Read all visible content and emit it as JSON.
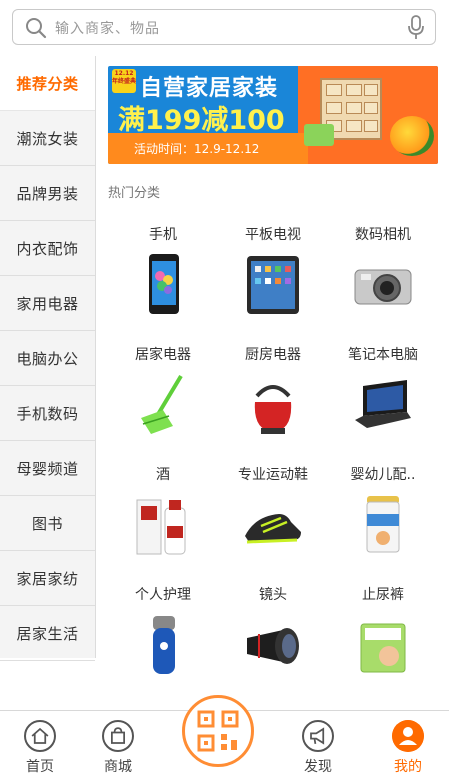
{
  "search": {
    "placeholder": "输入商家、物品"
  },
  "sidebar": {
    "items": [
      {
        "label": "推荐分类",
        "active": true
      },
      {
        "label": "潮流女装"
      },
      {
        "label": "品牌男装"
      },
      {
        "label": "内衣配饰"
      },
      {
        "label": "家用电器"
      },
      {
        "label": "电脑办公"
      },
      {
        "label": "手机数码"
      },
      {
        "label": "母婴频道"
      },
      {
        "label": "图书"
      },
      {
        "label": "家居家纺"
      },
      {
        "label": "居家生活"
      }
    ]
  },
  "banner": {
    "tag": "12.12 年终盛典",
    "title": "自营家居家装",
    "subtitle": "满199减100",
    "date": "活动时间：12.9-12.12"
  },
  "hot": {
    "title": "热门分类",
    "items": [
      {
        "label": "手机",
        "icon": "phone-icon"
      },
      {
        "label": "平板电视",
        "icon": "tablet-icon"
      },
      {
        "label": "数码相机",
        "icon": "camera-icon"
      },
      {
        "label": "居家电器",
        "icon": "broom-icon"
      },
      {
        "label": "厨房电器",
        "icon": "kettle-icon"
      },
      {
        "label": "笔记本电脑",
        "icon": "laptop-icon"
      },
      {
        "label": "酒",
        "icon": "liquor-icon"
      },
      {
        "label": "专业运动鞋",
        "icon": "sneaker-icon"
      },
      {
        "label": "婴幼儿配..",
        "icon": "formula-can-icon"
      },
      {
        "label": "个人护理",
        "icon": "shaver-icon"
      },
      {
        "label": "镜头",
        "icon": "lens-icon"
      },
      {
        "label": "止尿裤",
        "icon": "diaper-icon"
      }
    ]
  },
  "tabbar": {
    "items": [
      {
        "label": "首页",
        "icon": "home-icon"
      },
      {
        "label": "商城",
        "icon": "shopping-bag-icon"
      },
      {
        "label": "",
        "icon": "qr-scan-icon"
      },
      {
        "label": "发现",
        "icon": "megaphone-icon"
      },
      {
        "label": "我的",
        "icon": "user-icon",
        "active": true
      }
    ]
  },
  "colors": {
    "accent": "#ff6a00",
    "banner_blue": "#1a86d8"
  }
}
